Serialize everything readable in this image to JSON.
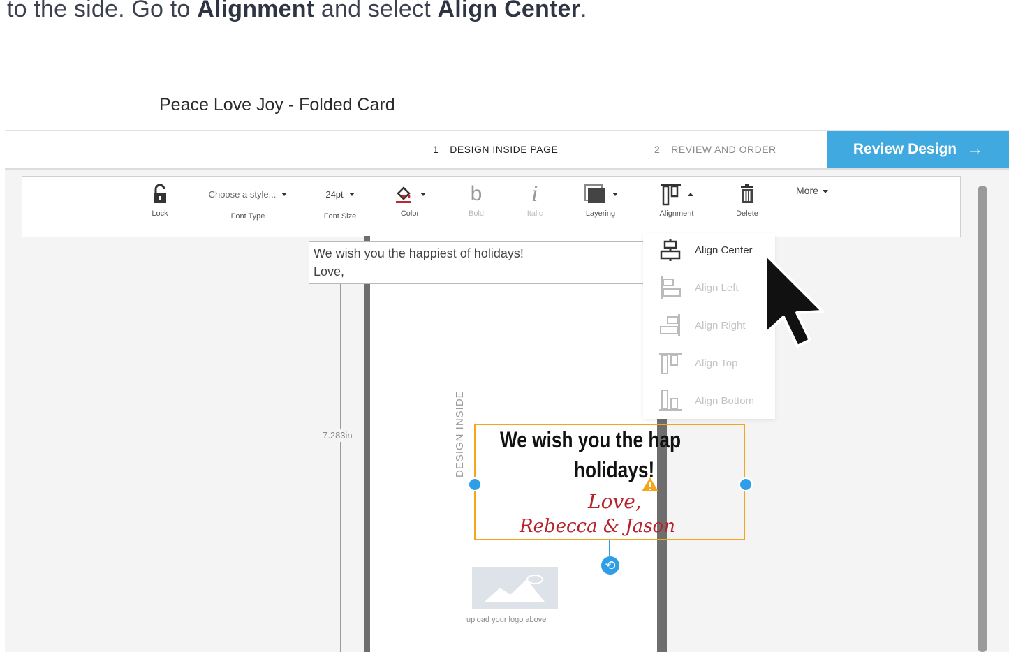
{
  "instruction": {
    "part1": "to the side. Go to ",
    "bold1": "Alignment",
    "part2": " and select ",
    "bold2": "Align Center",
    "part3": "."
  },
  "app": {
    "title": "Peace Love Joy - Folded Card"
  },
  "steps": [
    {
      "num": "1",
      "label": "DESIGN INSIDE PAGE"
    },
    {
      "num": "2",
      "label": "REVIEW AND ORDER"
    }
  ],
  "review_button": {
    "label": "Review Design",
    "arrow": "→"
  },
  "toolbar": {
    "lock": "Lock",
    "font_type_value": "Choose a style...",
    "font_type": "Font Type",
    "font_size_value": "24pt",
    "font_size": "Font Size",
    "color": "Color",
    "bold_glyph": "b",
    "bold": "Bold",
    "italic_glyph": "i",
    "italic": "Italic",
    "layering": "Layering",
    "alignment": "Alignment",
    "delete": "Delete",
    "more": "More"
  },
  "text_editor": {
    "line1": "We wish you the happiest of holidays!",
    "line2": "Love,"
  },
  "ruler": {
    "label": "7.283in"
  },
  "card": {
    "side_label": "DESIGN INSIDE",
    "line1": "We wish you the hap",
    "line2": "holidays!",
    "line3": "Love,",
    "line4": "Rebecca & Jason",
    "logo_caption": "upload your logo above"
  },
  "alignment_menu": {
    "items": [
      {
        "label": "Align Center",
        "icon": "align-center-icon",
        "enabled": true
      },
      {
        "label": "Align Left",
        "icon": "align-left-icon",
        "enabled": false
      },
      {
        "label": "Align Right",
        "icon": "align-right-icon",
        "enabled": false
      },
      {
        "label": "Align Top",
        "icon": "align-top-icon",
        "enabled": false
      },
      {
        "label": "Align Bottom",
        "icon": "align-bottom-icon",
        "enabled": false
      }
    ]
  },
  "colors": {
    "accent": "#40a9e0",
    "selection": "#f4a51c",
    "handle": "#2e9fe6",
    "script_text": "#b6222b"
  }
}
